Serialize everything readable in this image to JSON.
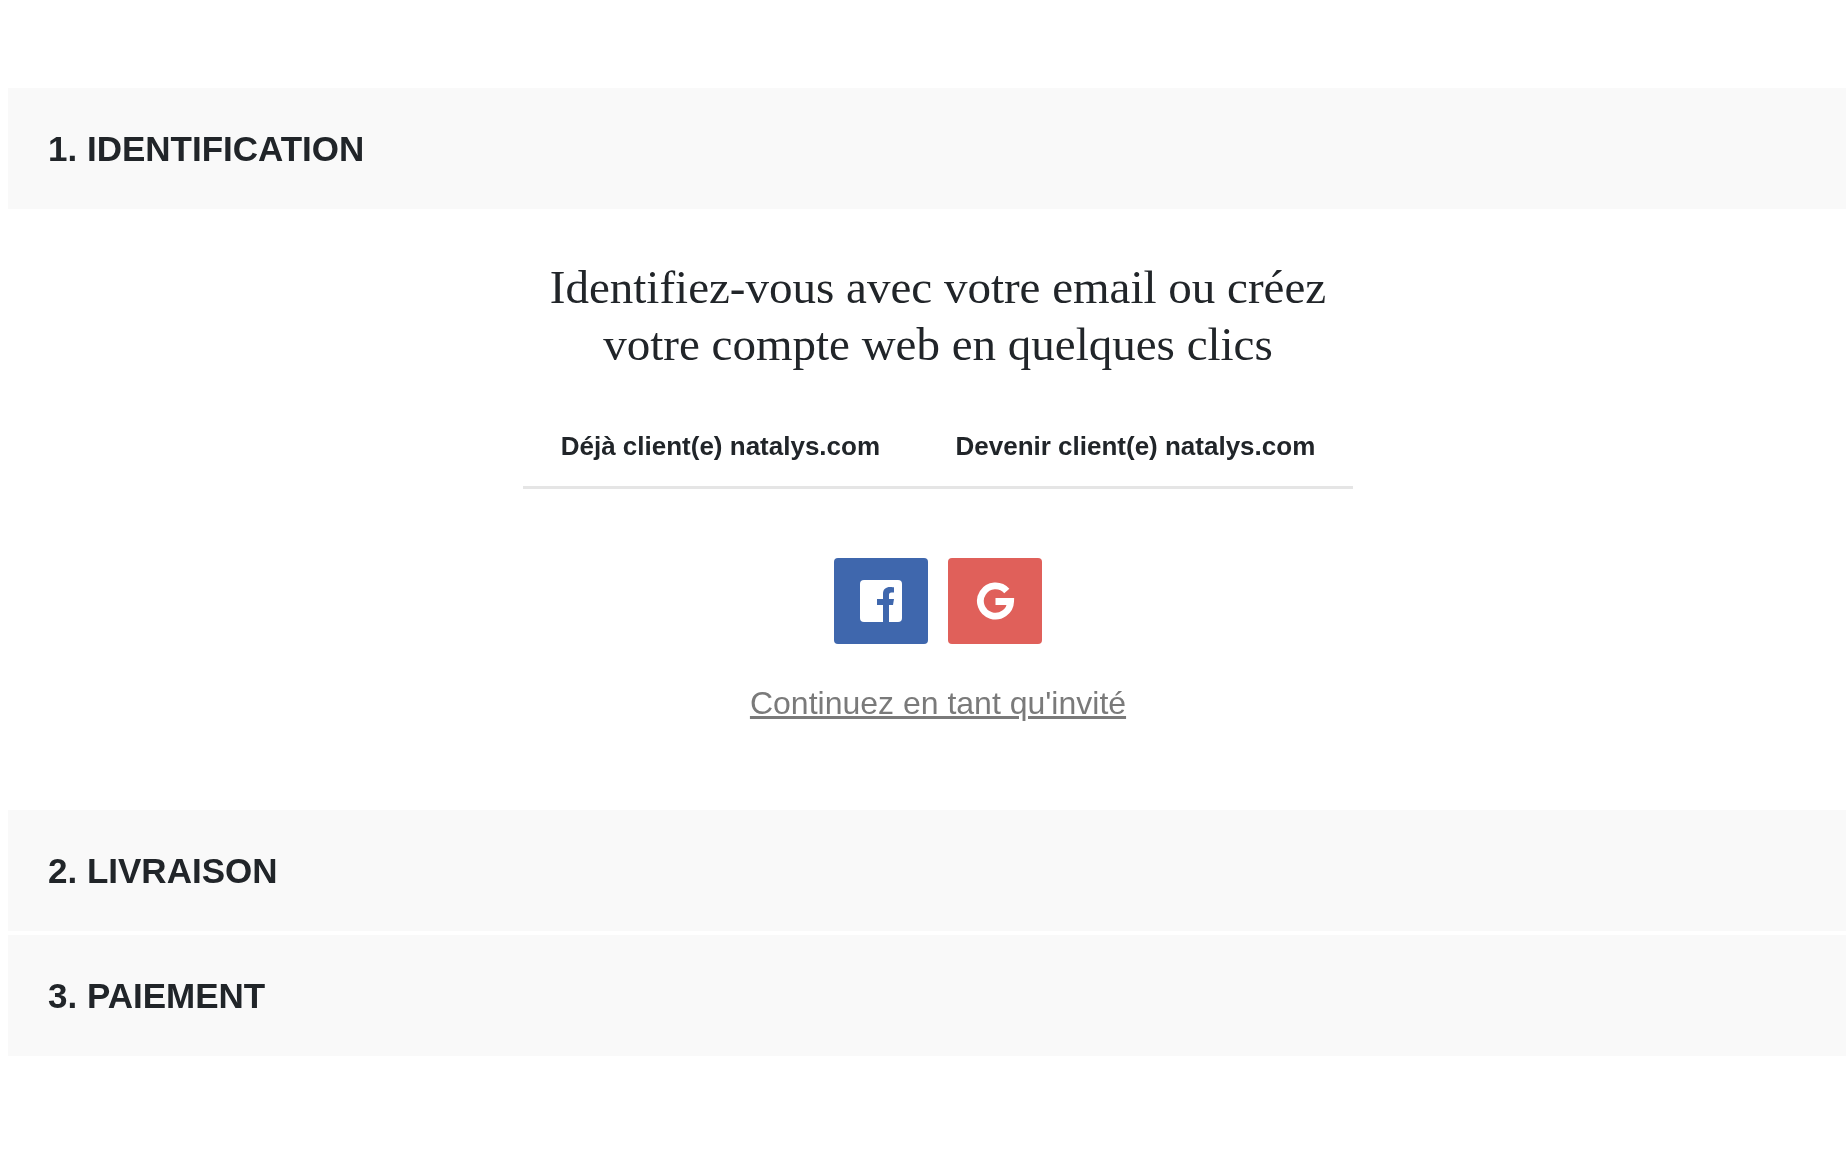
{
  "sections": [
    {
      "title": "1. IDENTIFICATION",
      "content": {
        "intro": "Identifiez-vous avec votre email ou créez votre compte web en quelques clics",
        "tabs": [
          {
            "label": "Déjà client(e) natalys.com",
            "selected": false
          },
          {
            "label": "Devenir client(e) natalys.com",
            "selected": false
          }
        ],
        "social_buttons": [
          {
            "kind": "facebook"
          },
          {
            "kind": "google"
          }
        ],
        "guest_link": "Continuez en tant qu'invité"
      }
    },
    {
      "title": "2. LIVRAISON"
    },
    {
      "title": "3. PAIEMENT"
    }
  ]
}
